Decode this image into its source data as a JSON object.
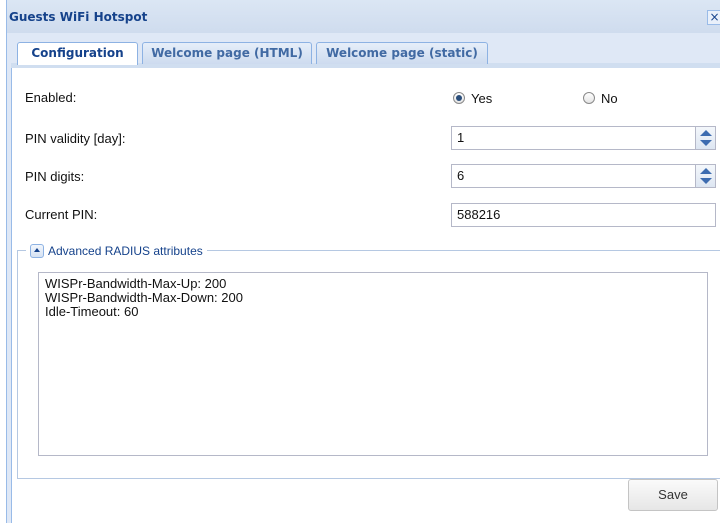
{
  "window": {
    "title": "Guests WiFi Hotspot",
    "close_icon": "close-icon",
    "close_glyph": "×"
  },
  "tabs": [
    {
      "label": "Configuration",
      "active": true
    },
    {
      "label": "Welcome page (HTML)",
      "active": false
    },
    {
      "label": "Welcome page (static)",
      "active": false
    }
  ],
  "form": {
    "enabled": {
      "label": "Enabled:",
      "options": [
        {
          "label": "Yes",
          "checked": true
        },
        {
          "label": "No",
          "checked": false
        }
      ]
    },
    "pin_validity": {
      "label": "PIN validity [day]:",
      "value": "1"
    },
    "pin_digits": {
      "label": "PIN digits:",
      "value": "6"
    },
    "current_pin": {
      "label": "Current PIN:",
      "value": "588216"
    }
  },
  "advanced": {
    "legend": "Advanced RADIUS attributes",
    "lines": [
      "WISPr-Bandwidth-Max-Up: 200",
      "WISPr-Bandwidth-Max-Down: 200",
      "Idle-Timeout: 60"
    ]
  },
  "footer": {
    "save_label": "Save"
  },
  "colors": {
    "accent": "#15428b",
    "window_bg": "#dfe8f6",
    "border": "#99bbe8"
  }
}
